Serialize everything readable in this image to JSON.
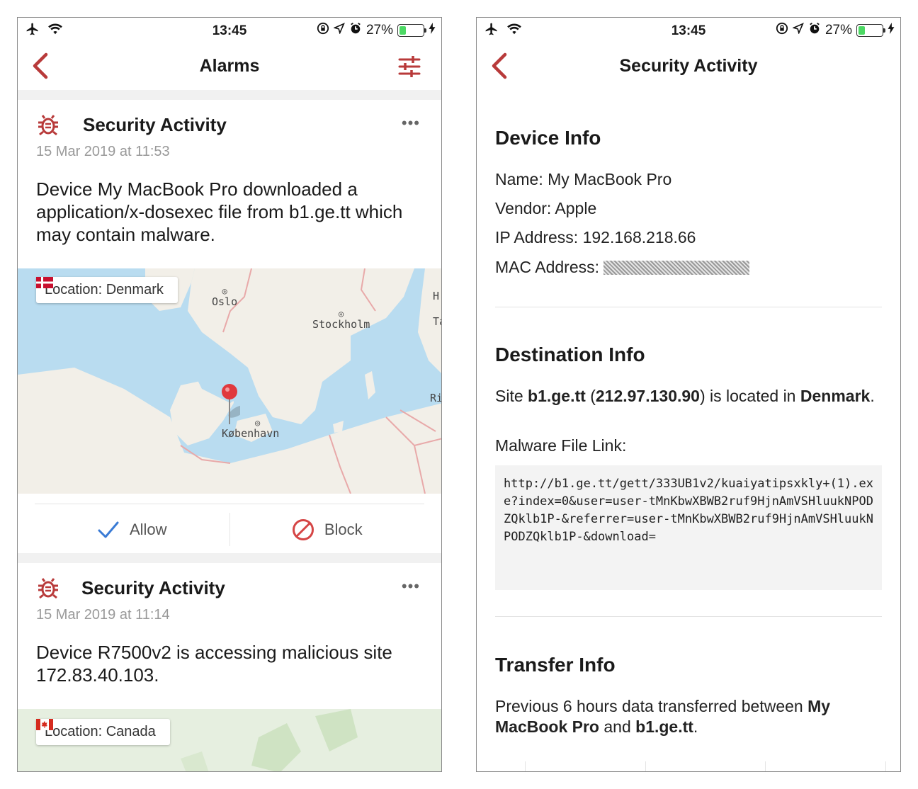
{
  "status_bar": {
    "time": "13:45",
    "battery": "27%",
    "battery_level": 0.27
  },
  "colors": {
    "accent": "#b83a3a",
    "check": "#3a7bd5",
    "map_water": "#b9dcf0",
    "map_land": "#f2efe8"
  },
  "alarms_screen": {
    "title": "Alarms",
    "cards": [
      {
        "icon": "bug-icon",
        "title": "Security Activity",
        "more": "•••",
        "date": "15 Mar 2019 at 11:53",
        "message": "Device My MacBook Pro downloaded a application/x-dosexec file from b1.ge.tt which may contain malware.",
        "location": "Location: Denmark",
        "flag": "denmark-flag",
        "map_labels": [
          "Oslo",
          "Stockholm",
          "København",
          "H",
          "Ta",
          "Ri"
        ],
        "actions": {
          "allow": "Allow",
          "block": "Block"
        }
      },
      {
        "icon": "bug-icon",
        "title": "Security Activity",
        "more": "•••",
        "date": "15 Mar 2019 at 11:14",
        "message": "Device R7500v2 is accessing malicious site 172.83.40.103.",
        "location": "Location: Canada",
        "flag": "canada-flag"
      }
    ]
  },
  "detail_screen": {
    "title": "Security Activity",
    "device_info": {
      "heading": "Device Info",
      "name": "Name: My MacBook Pro",
      "vendor": "Vendor: Apple",
      "ip": "IP Address: 192.168.218.66",
      "mac_label": "MAC Address:"
    },
    "destination_info": {
      "heading": "Destination Info",
      "site_prefix": "Site ",
      "site": "b1.ge.tt",
      "ip_open": " (",
      "ip": "212.97.130.90",
      "ip_close": ") is located in ",
      "country": "Denmark",
      "end": ".",
      "malware_label": "Malware File Link:",
      "malware_link": "http://b1.ge.tt/gett/333UB1v2/kuaiyatipsxkly+(1).exe?index=0&user=user-tMnKbwXBWB2ruf9HjnAmVSHluukNPODZQklb1P-&referrer=user-tMnKbwXBWB2ruf9HjnAmVSHluukNPODZQklb1P-&download="
    },
    "transfer_info": {
      "heading": "Transfer Info",
      "text_prefix": "Previous 6 hours data transferred between ",
      "device": "My MacBook Pro",
      "and": " and ",
      "site": "b1.ge.tt",
      "end": "."
    }
  }
}
